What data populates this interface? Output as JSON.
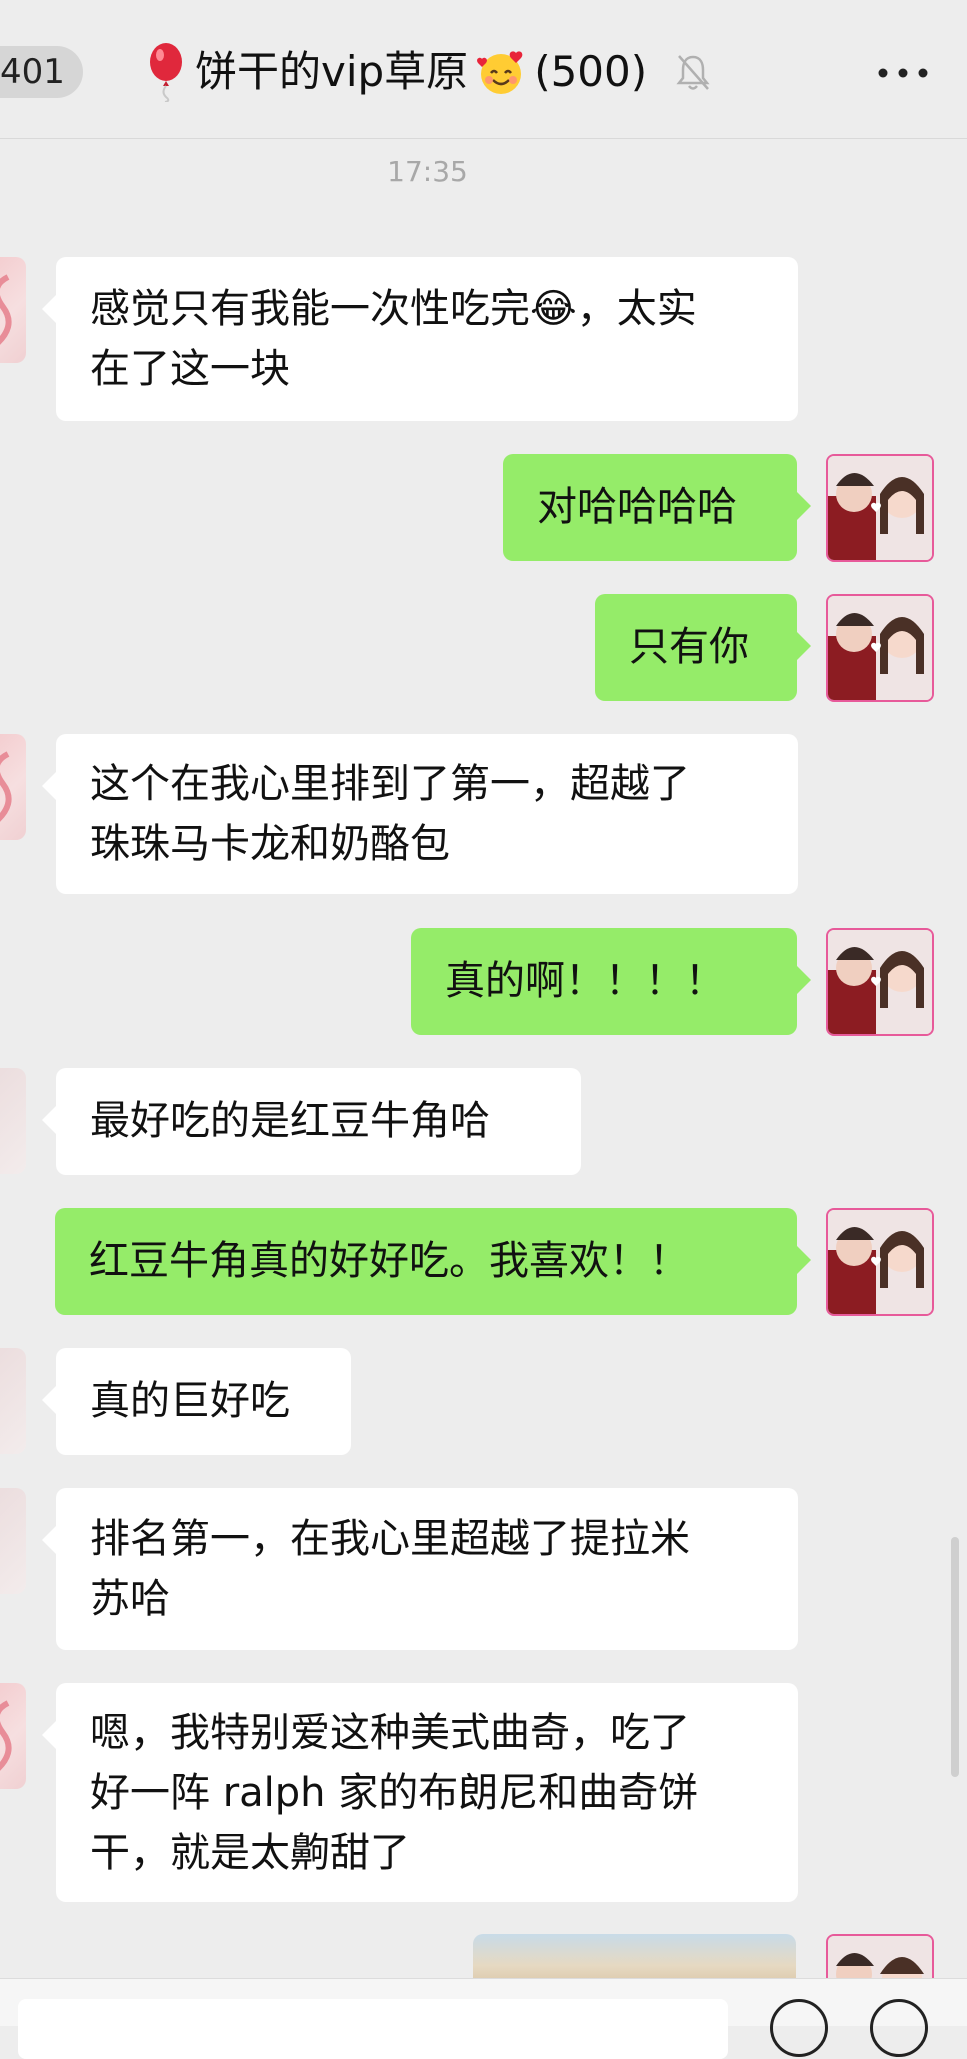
{
  "header": {
    "back_badge": "401",
    "group_title": "饼干的vip草原",
    "member_count": "(500)",
    "balloon_icon": "red-balloon-icon",
    "title_emoji": "smiling-face-with-hearts-emoji",
    "mute_icon": "bell-muted-icon",
    "more_icon": "more-dots-icon"
  },
  "timestamp": "17:35",
  "messages": [
    {
      "side": "left",
      "text": "感觉只有我能一次性吃完😂，太实\n在了这一块"
    },
    {
      "side": "right",
      "text": "对哈哈哈哈"
    },
    {
      "side": "right",
      "text": "只有你"
    },
    {
      "side": "left",
      "text": "这个在我心里排到了第一，超越了\n珠珠马卡龙和奶酪包"
    },
    {
      "side": "right",
      "text": "真的啊！！！！"
    },
    {
      "side": "left",
      "text": "最好吃的是红豆牛角哈"
    },
    {
      "side": "right",
      "text": "红豆牛角真的好好吃。我喜欢！！"
    },
    {
      "side": "left",
      "text": "真的巨好吃"
    },
    {
      "side": "left",
      "text": "排名第一，在我心里超越了提拉米\n苏哈"
    },
    {
      "side": "left",
      "text": "嗯，我特别爱这种美式曲奇，吃了\n好一阵 ralph 家的布朗尼和曲奇饼\n干，就是太齁甜了"
    }
  ],
  "colors": {
    "background": "#ededed",
    "sent_bubble": "#95ec69",
    "received_bubble": "#ffffff",
    "avatar_border": "#e75a9a"
  }
}
